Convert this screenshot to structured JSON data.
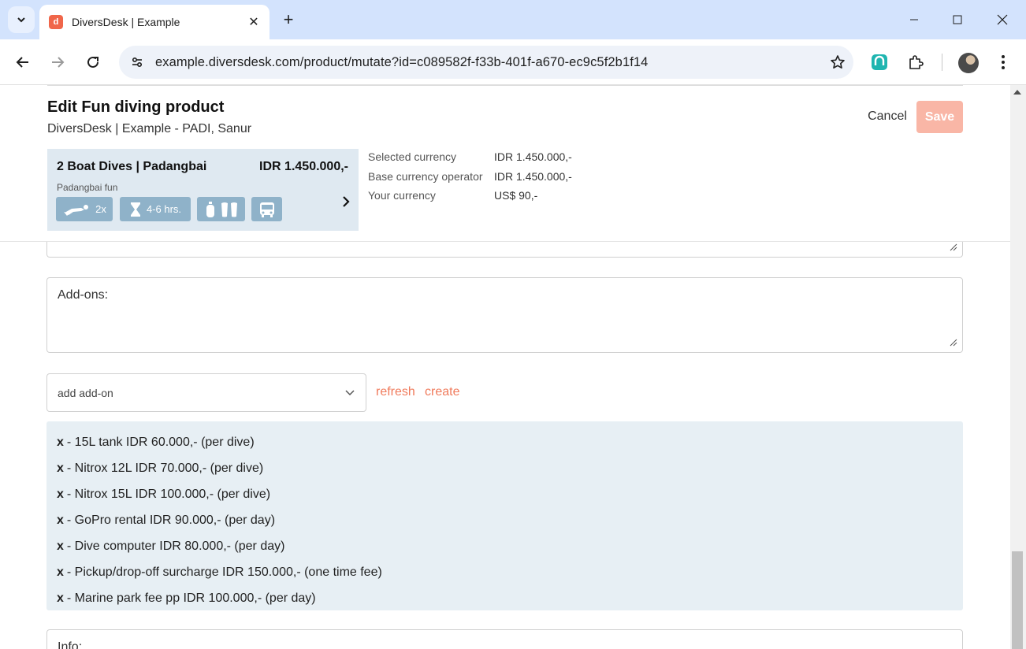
{
  "browser": {
    "tab_title": "DiversDesk | Example",
    "url": "example.diversdesk.com/product/mutate?id=c089582f-f33b-401f-a670-ec9c5f2b1f14",
    "accent": "#d3e3fd",
    "favicon_color": "#f0664a"
  },
  "header": {
    "title": "Edit Fun diving product",
    "subtitle": "DiversDesk | Example - PADI, Sanur",
    "cancel_label": "Cancel",
    "save_label": "Save"
  },
  "product": {
    "name": "2 Boat Dives | Padangbai",
    "price": "IDR 1.450.000,-",
    "location": "Padangbai fun",
    "dives": "2x",
    "duration": "4-6 hrs."
  },
  "currency": {
    "rows": [
      {
        "label": "Selected currency",
        "value": "IDR 1.450.000,-"
      },
      {
        "label": "Base currency operator",
        "value": "IDR 1.450.000,-"
      },
      {
        "label": "Your currency",
        "value": "US$ 90,-"
      }
    ]
  },
  "addons": {
    "label": "Add-ons:",
    "select_value": "add add-on",
    "refresh_label": "refresh",
    "create_label": "create",
    "remove_symbol": "x",
    "items": [
      "- 15L tank IDR 60.000,- (per dive)",
      "- Nitrox 12L IDR 70.000,- (per dive)",
      "- Nitrox 15L IDR 100.000,- (per dive)",
      "- GoPro rental IDR 90.000,- (per day)",
      "- Dive computer IDR 80.000,- (per day)",
      "- Pickup/drop-off surcharge IDR 150.000,- (one time fee)",
      "- Marine park fee pp IDR 100.000,- (per day)"
    ]
  },
  "info": {
    "label": "Info:"
  }
}
